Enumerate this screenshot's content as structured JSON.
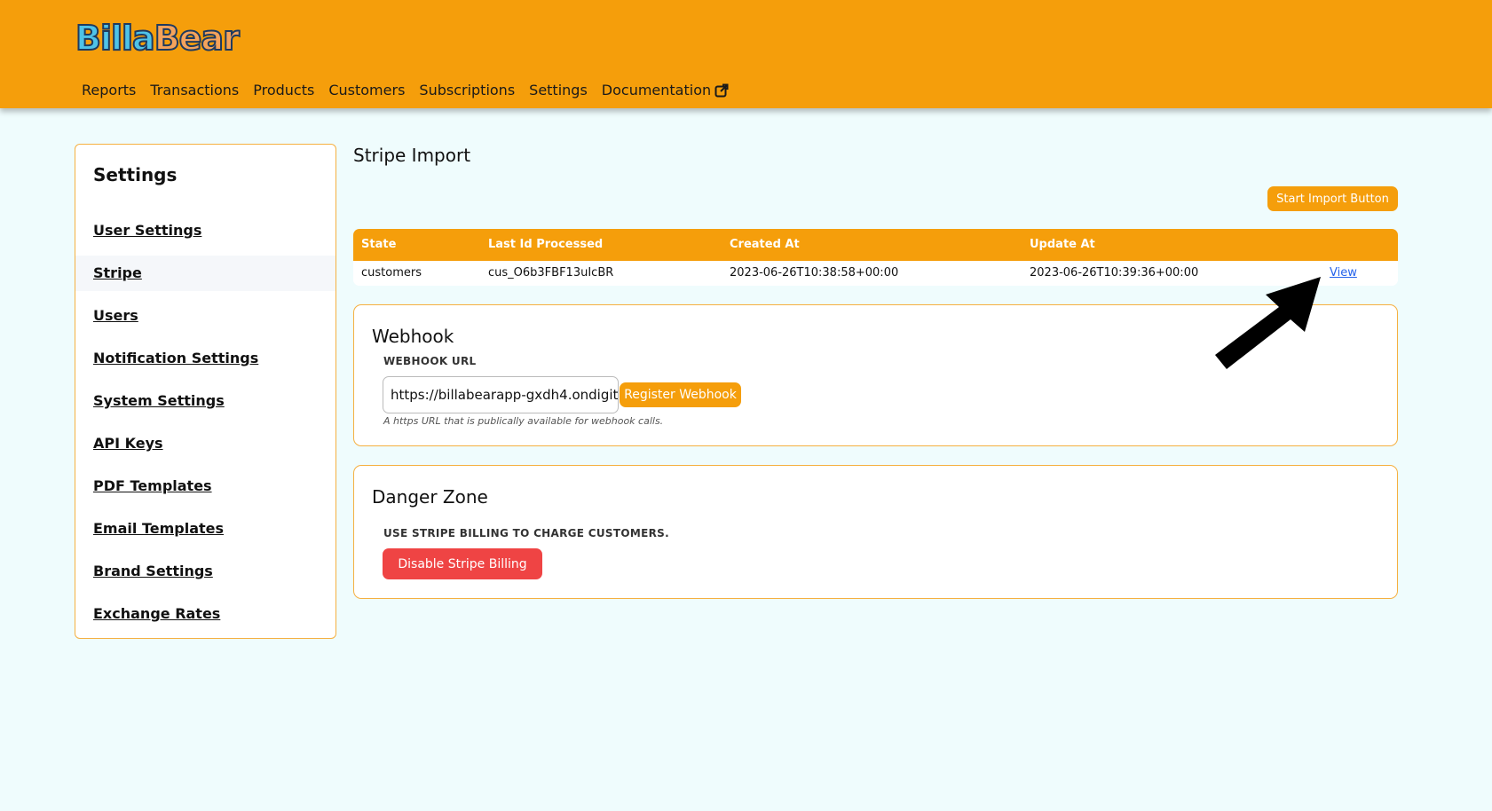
{
  "header": {
    "logo_part1": "Billa",
    "logo_part2": "Bear",
    "nav": [
      "Reports",
      "Transactions",
      "Products",
      "Customers",
      "Subscriptions",
      "Settings",
      "Documentation"
    ],
    "external_icon": "external-link-icon"
  },
  "sidebar": {
    "title": "Settings",
    "items": [
      {
        "label": "User Settings"
      },
      {
        "label": "Stripe",
        "active": true
      },
      {
        "label": "Users"
      },
      {
        "label": "Notification Settings"
      },
      {
        "label": "System Settings"
      },
      {
        "label": "API Keys"
      },
      {
        "label": "PDF Templates"
      },
      {
        "label": "Email Templates"
      },
      {
        "label": "Brand Settings"
      },
      {
        "label": "Exchange Rates"
      }
    ]
  },
  "main": {
    "title": "Stripe Import",
    "start_import_label": "Start Import Button",
    "table": {
      "headers": [
        "State",
        "Last Id Processed",
        "Created At",
        "Update At"
      ],
      "rows": [
        {
          "state": "customers",
          "last_id": "cus_O6b3FBF13uIcBR",
          "created_at": "2023-06-26T10:38:58+00:00",
          "updated_at": "2023-06-26T10:39:36+00:00",
          "action": "View"
        }
      ]
    },
    "webhook": {
      "title": "Webhook",
      "label": "WEBHOOK URL",
      "url_value": "https://billabearapp-gxdh4.ondigit",
      "register_label": "Register Webhook",
      "help": "A https URL that is publically available for webhook calls."
    },
    "danger": {
      "title": "Danger Zone",
      "label": "USE STRIPE BILLING TO CHARGE CUSTOMERS.",
      "button_label": "Disable Stripe Billing"
    }
  },
  "colors": {
    "accent": "#f59e0b",
    "background": "#effcfd",
    "danger": "#ef4444",
    "link": "#2563eb"
  },
  "annotation_icon": "arrow-pointer-icon"
}
